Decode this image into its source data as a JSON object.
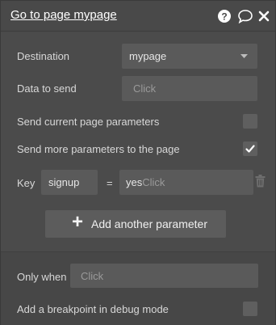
{
  "header": {
    "title": "Go to page mypage",
    "icons": [
      "help-icon",
      "comment-icon",
      "close-icon"
    ]
  },
  "destination": {
    "label": "Destination",
    "value": "mypage"
  },
  "data_to_send": {
    "label": "Data to send",
    "placeholder": "Click"
  },
  "send_current": {
    "label": "Send current page parameters",
    "checked": false
  },
  "send_more": {
    "label": "Send more parameters to the page",
    "checked": true
  },
  "param": {
    "key_label": "Key",
    "key_value": "signup",
    "equals": "=",
    "value": "yes",
    "value_placeholder": "Click"
  },
  "add_param": {
    "label": "Add another parameter",
    "plus": "+"
  },
  "only_when": {
    "label": "Only when",
    "placeholder": "Click"
  },
  "breakpoint": {
    "label": "Add a breakpoint in debug mode",
    "checked": false
  }
}
